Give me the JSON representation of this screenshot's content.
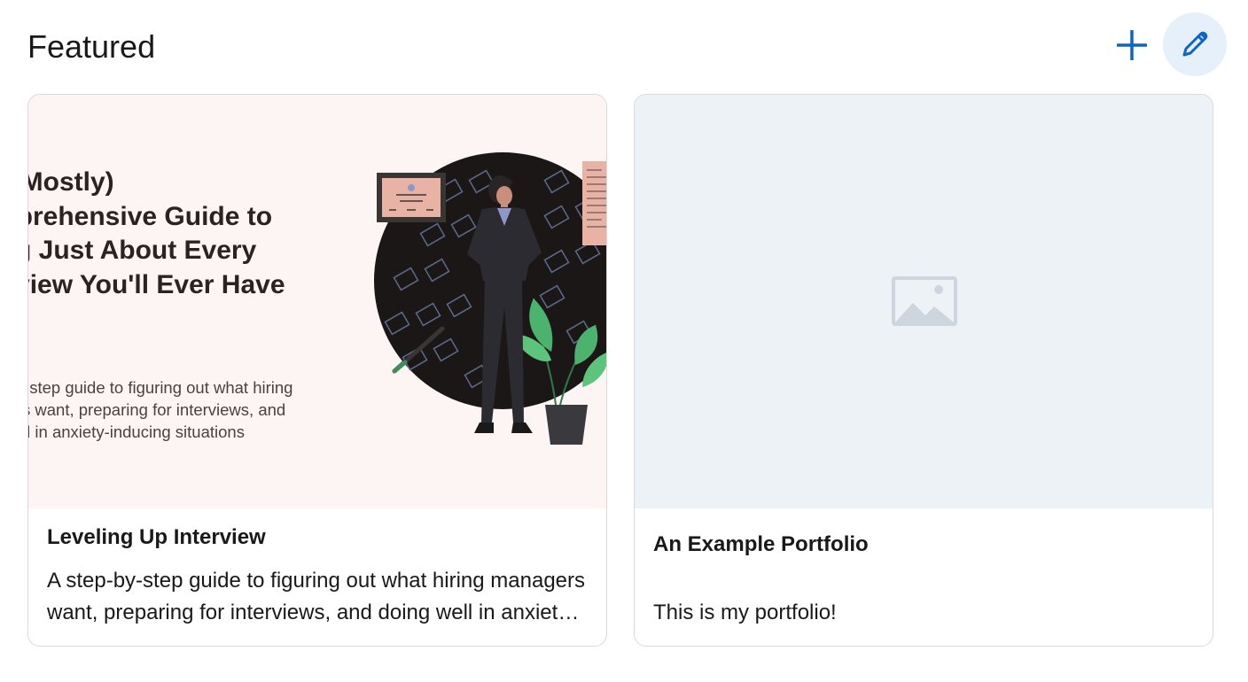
{
  "section": {
    "title": "Featured"
  },
  "actions": {
    "add_icon": "plus-icon",
    "edit_icon": "pencil-icon",
    "accent_color": "#0a66c2",
    "edit_bg_color": "#e6f0fb"
  },
  "cards": [
    {
      "thumbnail": {
        "title": "The (Mostly)\nComprehensive Guide to\nAcing Just About Every\nInterview You'll Ever Have",
        "subtitle": "A step by step guide to figuring out what hiring\nmanagers want, preparing for interviews, and\ndoing well in anxiety-inducing situations",
        "background": "#fdf5f4"
      },
      "heading": "Leveling Up Interview",
      "description": "A step-by-step guide to figuring out what hiring managers want, preparing for interviews, and doing well in anxiety-inducing situations"
    },
    {
      "thumbnail": {
        "icon": "image-placeholder-icon",
        "background": "#edf2f7"
      },
      "heading": "An Example Portfolio",
      "description": "This is my portfolio!"
    }
  ]
}
